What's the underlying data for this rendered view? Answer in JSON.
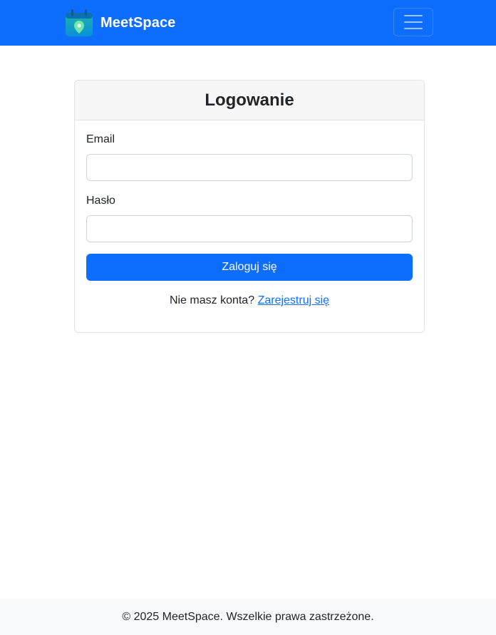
{
  "navbar": {
    "brand_name": "MeetSpace",
    "logo_icon": "calendar-location-icon",
    "menu_icon": "hamburger-menu-icon",
    "background_color": "#0d6efd"
  },
  "login_card": {
    "title": "Logowanie",
    "email_label": "Email",
    "email_value": "",
    "password_label": "Hasło",
    "password_value": "",
    "submit_label": "Zaloguj się",
    "register_prompt": "Nie masz konta?",
    "register_link": "Zarejestruj się"
  },
  "footer": {
    "text": "© 2025 MeetSpace. Wszelkie prawa zastrzeżone."
  },
  "colors": {
    "primary": "#0d6efd",
    "header_bg": "#f7f7f7",
    "footer_bg": "#f8f9fa"
  }
}
